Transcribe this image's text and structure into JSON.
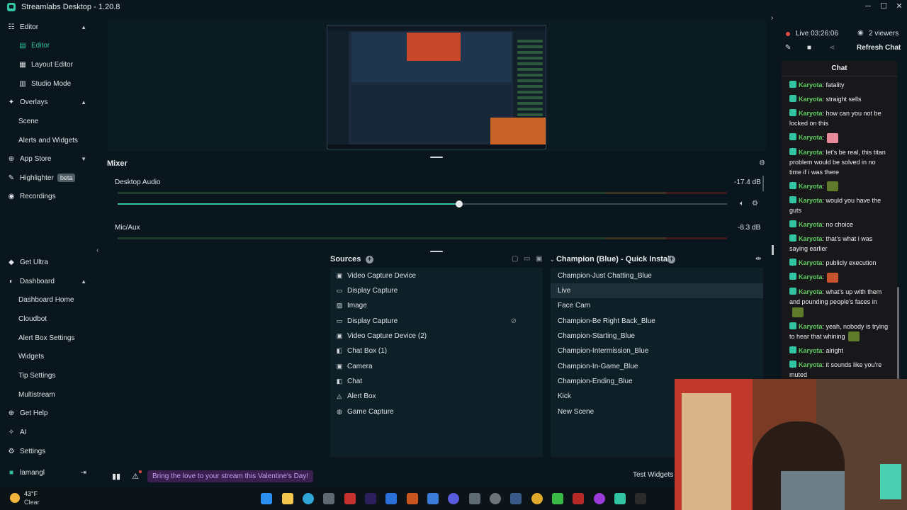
{
  "window": {
    "title": "Streamlabs Desktop - 1.20.8",
    "minimize": "─",
    "maximize": "☐",
    "close": "✕"
  },
  "sidebar": {
    "editor": "Editor",
    "editor_sub": "Editor",
    "layout_editor": "Layout Editor",
    "studio_mode": "Studio Mode",
    "overlays": "Overlays",
    "scene": "Scene",
    "alerts_widgets": "Alerts and Widgets",
    "app_store": "App Store",
    "highlighter": "Highlighter",
    "beta": "beta",
    "recordings": "Recordings",
    "get_ultra": "Get Ultra",
    "dashboard": "Dashboard",
    "dashboard_home": "Dashboard Home",
    "cloudbot": "Cloudbot",
    "alert_box_settings": "Alert Box Settings",
    "widgets": "Widgets",
    "tip_settings": "Tip Settings",
    "multistream": "Multistream",
    "get_help": "Get Help",
    "ai": "AI",
    "settings": "Settings",
    "username": "lamangl"
  },
  "mixer": {
    "title": "Mixer",
    "channels": [
      {
        "name": "Desktop Audio",
        "db": "-17.4 dB",
        "volume": 0.56
      },
      {
        "name": "Mic/Aux",
        "db": "-8.3 dB"
      }
    ]
  },
  "sources": {
    "title": "Sources",
    "items": [
      {
        "label": "Video Capture Device",
        "icon": "camera-icon"
      },
      {
        "label": "Display Capture",
        "icon": "monitor-icon"
      },
      {
        "label": "Image",
        "icon": "image-icon"
      },
      {
        "label": "Display Capture",
        "icon": "monitor-icon",
        "hidden": true
      },
      {
        "label": "Video Capture Device (2)",
        "icon": "camera-icon"
      },
      {
        "label": "Chat Box (1)",
        "icon": "chat-icon"
      },
      {
        "label": "Camera",
        "icon": "camera-icon"
      },
      {
        "label": "Chat",
        "icon": "chat-icon"
      },
      {
        "label": "Alert Box",
        "icon": "bell-icon"
      },
      {
        "label": "Game Capture",
        "icon": "gamepad-icon"
      }
    ]
  },
  "scenes": {
    "title": "Champion (Blue) - Quick Install",
    "selected": "Live",
    "items": [
      "Champion-Just Chatting_Blue",
      "Live",
      "Face Cam",
      "Champion-Be Right Back_Blue",
      "Champion-Starting_Blue",
      "Champion-Intermission_Blue",
      "Champion-In-Game_Blue",
      "Champion-Ending_Blue",
      "Kick",
      "New Scene"
    ]
  },
  "status_bar": {
    "promo": "Bring the love to your stream this Valentine's Day!",
    "test_widgets": "Test Widgets"
  },
  "chat": {
    "live_time": "Live 03:26:06",
    "viewers": "2 viewers",
    "refresh": "Refresh Chat",
    "header": "Chat",
    "messages": [
      {
        "user": "Karyota",
        "text": ": fatality"
      },
      {
        "user": "Karyota",
        "text": ": straight sells"
      },
      {
        "user": "Karyota",
        "text": ": how can you not be locked on this"
      },
      {
        "user": "Karyota",
        "text": ":",
        "emote": "pink"
      },
      {
        "user": "Karyota",
        "text": ": let's be real, this titan problem would be solved in no time if i was there"
      },
      {
        "user": "Karyota",
        "text": ":",
        "emote": "green"
      },
      {
        "user": "Karyota",
        "text": ": would you have the guts"
      },
      {
        "user": "Karyota",
        "text": ": no choice"
      },
      {
        "user": "Karyota",
        "text": ": that's what i was saying earlier"
      },
      {
        "user": "Karyota",
        "text": ": publicly execution"
      },
      {
        "user": "Karyota",
        "text": ":",
        "emote": "red"
      },
      {
        "user": "Karyota",
        "text": ": what's up with them and pounding people's faces in",
        "emote_after": "green"
      },
      {
        "user": "Karyota",
        "text": ": yeah, nobody is trying to hear that whining",
        "emote_after": "green"
      },
      {
        "user": "Karyota",
        "text": ": alright"
      },
      {
        "user": "Karyota",
        "text": ": it sounds like you're muted"
      }
    ]
  },
  "taskbar": {
    "temperature": "43°F",
    "condition": "Clear"
  },
  "colors": {
    "accent": "#31c3a2",
    "background": "#09161d",
    "chat_username": "#5fcf62",
    "live": "#e34c4c"
  }
}
